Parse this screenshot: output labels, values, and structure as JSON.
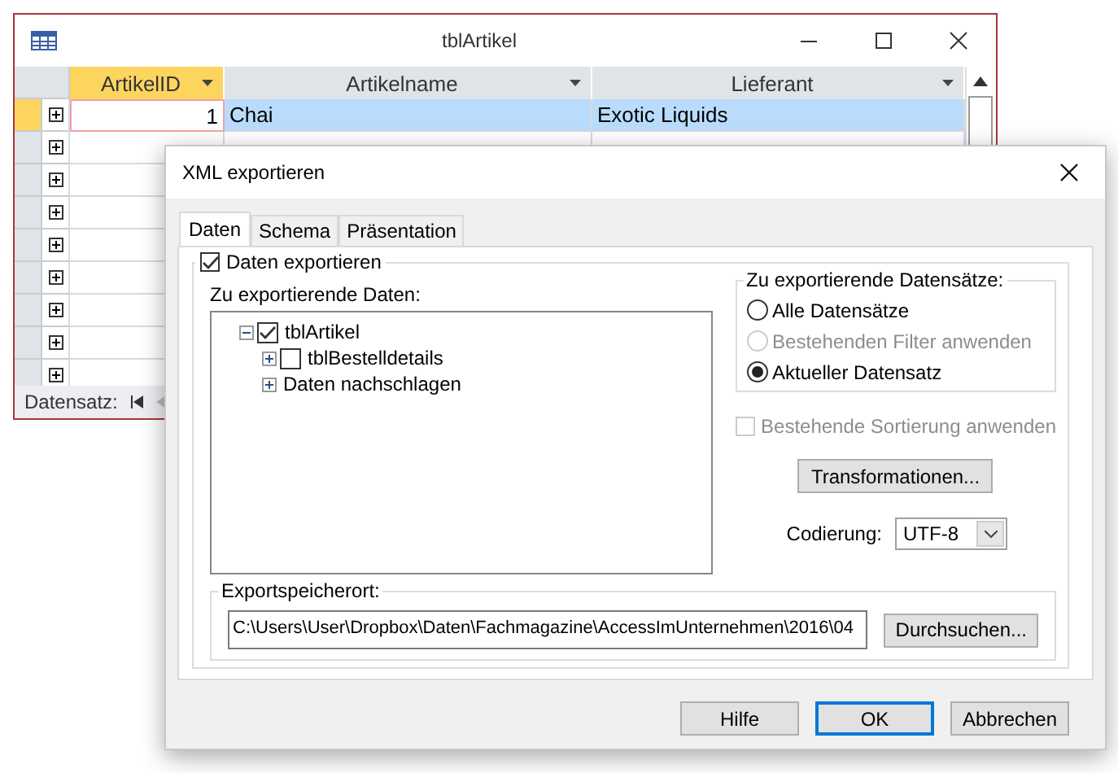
{
  "table_window": {
    "title": "tblArtikel",
    "columns": [
      {
        "label": "ArtikelID",
        "selected": true
      },
      {
        "label": "Artikelname",
        "selected": false
      },
      {
        "label": "Lieferant",
        "selected": false
      }
    ],
    "rows": [
      {
        "selected": true,
        "cells": [
          "1",
          "Chai",
          "Exotic Liquids"
        ]
      }
    ],
    "footer_label": "Datensatz:"
  },
  "dialog": {
    "title": "XML exportieren",
    "tabs": [
      {
        "label": "Daten",
        "selected": true
      },
      {
        "label": "Schema",
        "selected": false
      },
      {
        "label": "Präsentation",
        "selected": false
      }
    ],
    "export_data": {
      "label": "Daten exportieren",
      "checked": true
    },
    "data_label": "Zu exportierende Daten:",
    "tree": [
      {
        "label": "tblArtikel",
        "kind": "checkbox",
        "checked": true,
        "expanded": true,
        "children": [
          {
            "label": "tblBestelldetails",
            "kind": "checkbox",
            "checked": false,
            "expanded": false
          },
          {
            "label": "Daten nachschlagen",
            "kind": "plain",
            "expanded": false
          }
        ]
      }
    ],
    "records": {
      "title": "Zu exportierende Datensätze:",
      "options": [
        {
          "label": "Alle Datensätze",
          "selected": false,
          "disabled": false
        },
        {
          "label": "Bestehenden Filter anwenden",
          "selected": false,
          "disabled": true
        },
        {
          "label": "Aktueller Datensatz",
          "selected": true,
          "disabled": false
        }
      ]
    },
    "sort": {
      "label": "Bestehende Sortierung anwenden",
      "checked": false,
      "disabled": true
    },
    "transform_button": "Transformationen...",
    "encoding": {
      "label": "Codierung:",
      "value": "UTF-8"
    },
    "location": {
      "title": "Exportspeicherort:",
      "path": "C:\\Users\\User\\Dropbox\\Daten\\Fachmagazine\\AccessImUnternehmen\\2016\\04",
      "browse_button": "Durchsuchen..."
    },
    "buttons": [
      {
        "label": "Hilfe",
        "default": false
      },
      {
        "label": "OK",
        "default": true
      },
      {
        "label": "Abbrechen",
        "default": false
      }
    ]
  }
}
